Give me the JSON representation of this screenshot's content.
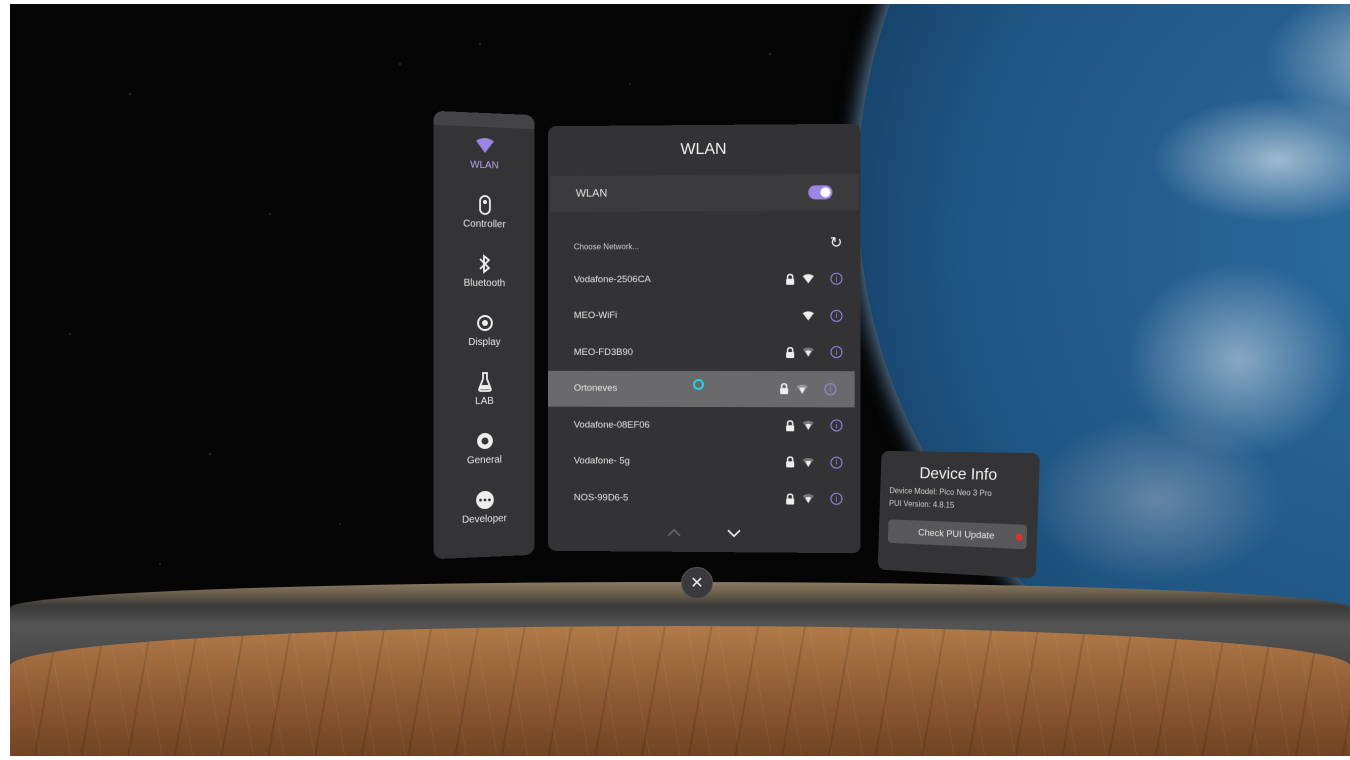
{
  "panel": {
    "title": "WLAN"
  },
  "sidebar": {
    "items": [
      {
        "label": "WLAN",
        "icon": "wifi-icon",
        "active": true
      },
      {
        "label": "Controller",
        "icon": "controller-icon"
      },
      {
        "label": "Bluetooth",
        "icon": "bluetooth-icon"
      },
      {
        "label": "Display",
        "icon": "eye-icon"
      },
      {
        "label": "LAB",
        "icon": "flask-icon"
      },
      {
        "label": "General",
        "icon": "gear-icon"
      },
      {
        "label": "Developer",
        "icon": "more-icon"
      }
    ]
  },
  "wlan": {
    "toggle_label": "WLAN",
    "enabled": true,
    "choose_label": "Choose Network...",
    "networks": [
      {
        "name": "Vodafone-2506CA",
        "locked": true,
        "strength": "full"
      },
      {
        "name": "MEO-WiFi",
        "locked": false,
        "strength": "full"
      },
      {
        "name": "MEO-FD3B90",
        "locked": true,
        "strength": "weak"
      },
      {
        "name": "Ortoneves",
        "locked": true,
        "strength": "weak",
        "selected": true
      },
      {
        "name": "Vodafone-08EF06",
        "locked": true,
        "strength": "weak"
      },
      {
        "name": "Vodafone- 5g",
        "locked": true,
        "strength": "weak"
      },
      {
        "name": "NOS-99D6-5",
        "locked": true,
        "strength": "weak"
      }
    ],
    "info_glyph": "i"
  },
  "pager": {
    "up": "^",
    "down": "v"
  },
  "device_info": {
    "title": "Device Info",
    "model": "Device Model: Pico Neo 3 Pro",
    "version": "PUI Version: 4.8.15",
    "update_button": "Check PUI Update"
  },
  "close": {
    "glyph": "✕"
  },
  "colors": {
    "accent": "#9b86e6",
    "cursor": "#28d0e8",
    "badge": "#e5302a"
  }
}
